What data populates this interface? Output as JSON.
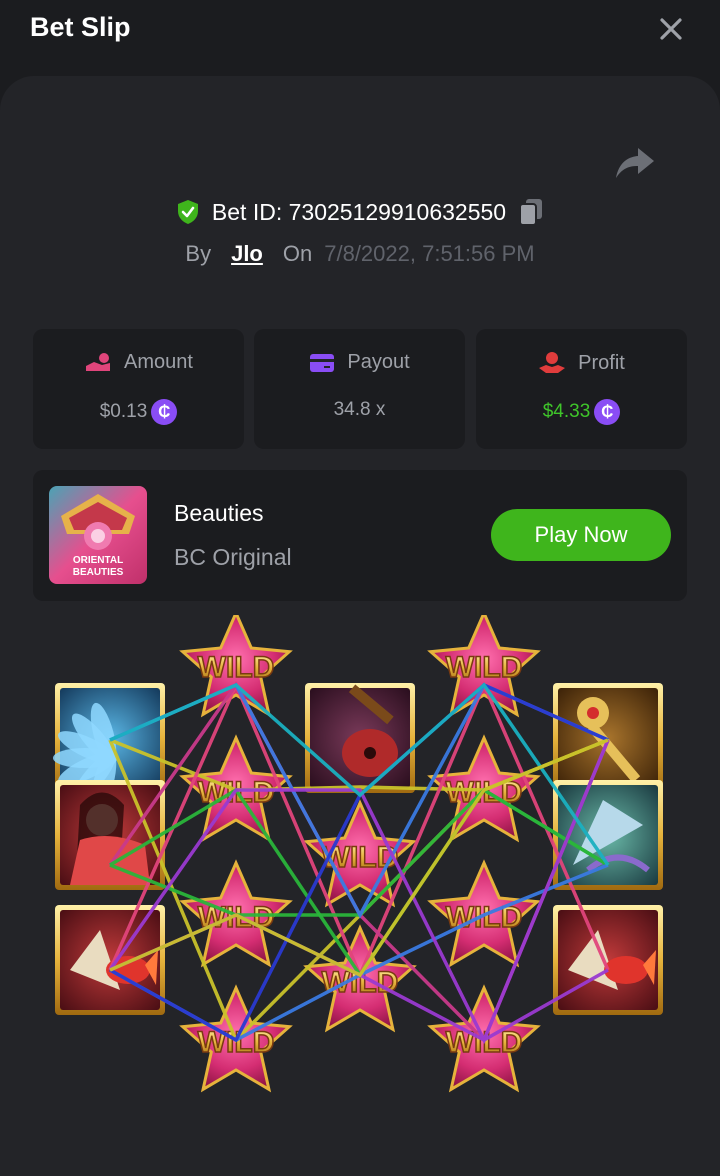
{
  "header": {
    "title": "Bet Slip"
  },
  "bet": {
    "id_text": "Bet ID: 73025129910632550",
    "by_label": "By",
    "user": "Jlo",
    "on_label": "On",
    "date": "7/8/2022, 7:51:56 PM"
  },
  "stats": [
    {
      "label": "Amount",
      "value": "$0.13",
      "value_color": "#9ea1a8",
      "icon": "coins-hand-icon",
      "coin": "₵"
    },
    {
      "label": "Payout",
      "value": "34.8 x",
      "value_color": "#9ea1a8",
      "icon": "card-icon"
    },
    {
      "label": "Profit",
      "value": "$4.33",
      "value_color": "#3fc52a",
      "icon": "profit-icon",
      "coin": "₵"
    }
  ],
  "game": {
    "name": "Beauties",
    "provider": "BC Original",
    "thumb_text": [
      "ORIENTAL",
      "BEAUTIES"
    ],
    "play_label": "Play Now"
  },
  "board": {
    "wild_label": "WILD",
    "columns": [
      [
        "lotus",
        "beauty",
        "fan-fish"
      ],
      [
        "wild",
        "wild",
        "wild",
        "wild"
      ],
      [
        "pipa",
        "wild",
        "wild"
      ],
      [
        "wild",
        "wild",
        "wild",
        "wild"
      ],
      [
        "scepter",
        "fan",
        "fan-fish"
      ]
    ]
  },
  "colors": {
    "accent_green": "#3fb51c",
    "profit_green": "#3fc52a",
    "coin_purple": "#8a4df5",
    "pink": "#e0457b"
  }
}
